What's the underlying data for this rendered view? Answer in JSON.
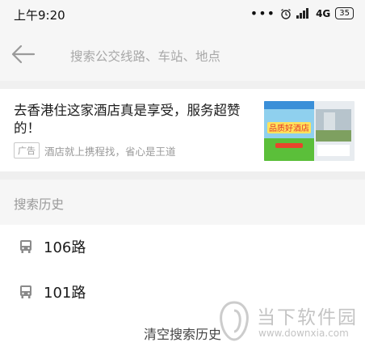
{
  "status_bar": {
    "time": "上午9:20",
    "dots": "•••",
    "network": "4G",
    "battery": "35",
    "icons": [
      "alarm-icon",
      "signal-icon",
      "battery-icon"
    ]
  },
  "search": {
    "placeholder": "搜索公交线路、车站、地点"
  },
  "ad": {
    "title": "去香港住这家酒店真是享受，服务超赞的！",
    "badge": "广告",
    "description": "酒店就上携程找，省心是王道",
    "image_text": "品质好酒店"
  },
  "history": {
    "title": "搜索历史",
    "items": [
      {
        "label": "106路",
        "icon": "bus-icon"
      },
      {
        "label": "101路",
        "icon": "bus-icon"
      }
    ],
    "clear_label": "清空搜索历史"
  },
  "watermark": {
    "name": "当下软件园",
    "url": "www.downxia.com"
  },
  "colors": {
    "header_bg": "#f6f6f6",
    "divider": "#efefef",
    "muted_text": "#9a9a9a",
    "primary_text": "#1b1b1b"
  }
}
